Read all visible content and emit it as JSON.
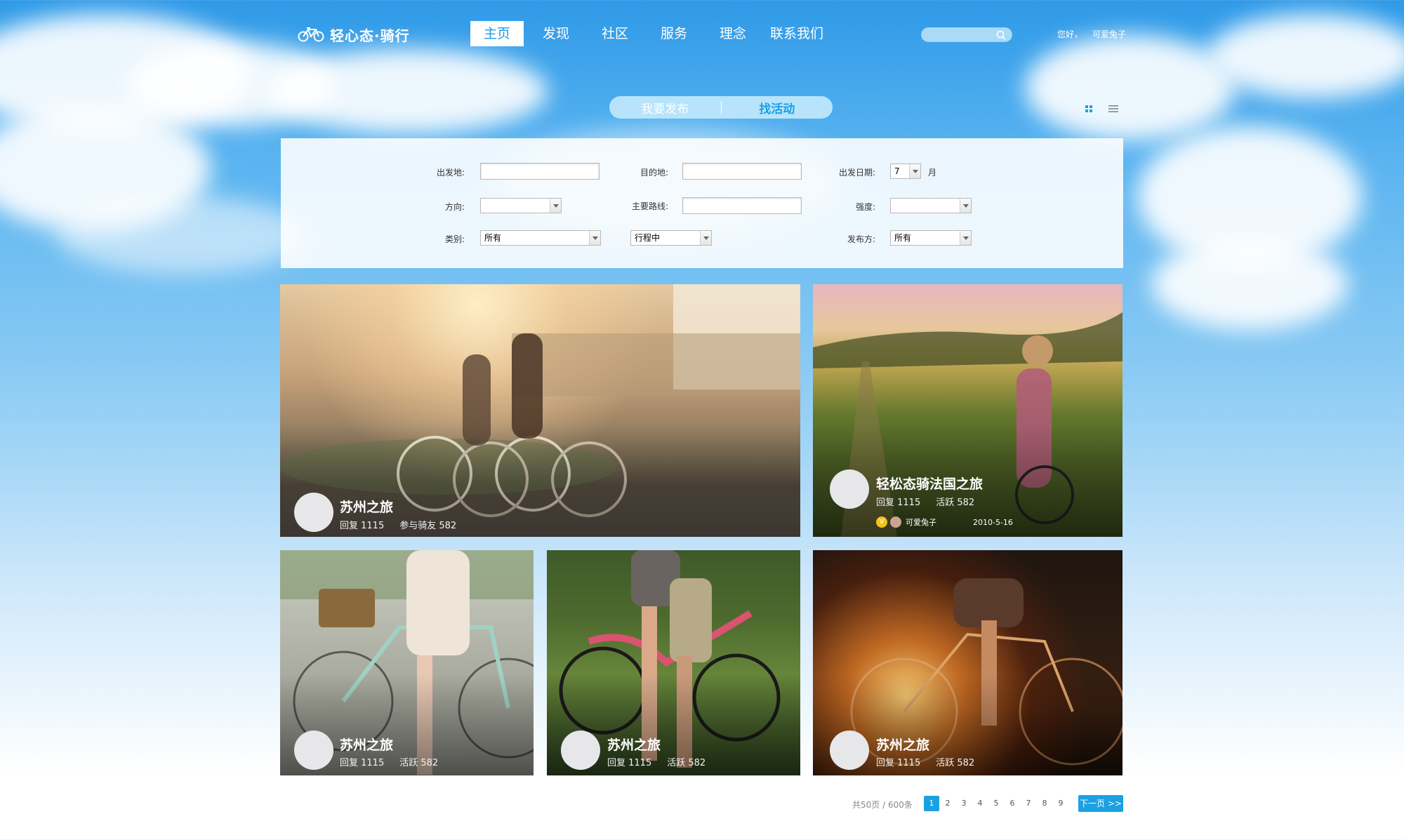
{
  "header": {
    "logo_text": "轻心态·骑行",
    "nav": [
      "主页",
      "发现",
      "社区",
      "服务",
      "理念",
      "联系我们"
    ],
    "active_nav_index": 0,
    "search": {
      "placeholder": "",
      "value": ""
    },
    "greeting": "您好，",
    "username": "可爱兔子"
  },
  "toggle": {
    "publish": "我要发布",
    "find": "找活动",
    "active": "find"
  },
  "view_modes": [
    "grid-icon",
    "list-icon"
  ],
  "filter": {
    "departure_label": "出发地:",
    "departure_value": "",
    "destination_label": "目的地:",
    "destination_value": "",
    "date_label": "出发日期:",
    "date_month": "7",
    "date_unit": "月",
    "direction_label": "方向:",
    "direction_value": "",
    "route_label": "主要路线:",
    "route_value": "",
    "intensity_label": "强度:",
    "intensity_value": "",
    "category_label": "类别:",
    "category_value": "所有",
    "status_value": "行程中",
    "publisher_label": "发布方:",
    "publisher_value": "所有"
  },
  "cards": [
    {
      "title": "苏州之旅",
      "stat1": "回复 1115",
      "stat2": "参与骑友 582"
    },
    {
      "title": "轻松态骑法国之旅",
      "stat1": "回复 1115",
      "stat2": "活跃 582",
      "badge": "V",
      "author": "可爱兔子",
      "date": "2010-5-16"
    },
    {
      "title": "苏州之旅",
      "stat1": "回复 1115",
      "stat2": "活跃 582"
    },
    {
      "title": "苏州之旅",
      "stat1": "回复 1115",
      "stat2": "活跃 582"
    },
    {
      "title": "苏州之旅",
      "stat1": "回复 1115",
      "stat2": "活跃 582"
    }
  ],
  "pagination": {
    "summary": "共50页 / 600条",
    "pages": [
      "1",
      "2",
      "3",
      "4",
      "5",
      "6",
      "7",
      "8",
      "9"
    ],
    "current": "1",
    "next": "下一页 >>"
  },
  "colors": {
    "accent": "#1ba1e2",
    "sky": "#2f9ae8"
  }
}
